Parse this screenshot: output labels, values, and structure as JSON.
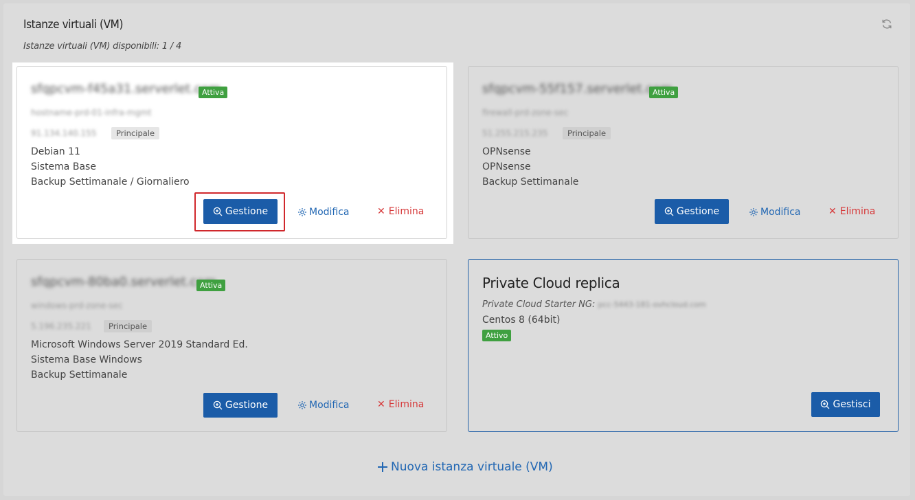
{
  "panel": {
    "title": "Istanze virtuali (VM)",
    "subtitle": "Istanze virtuali (VM) disponibili: 1 / 4"
  },
  "cards": [
    {
      "hostname": "sfqpcvm-f45a31.serverlet.com",
      "status": "Attiva",
      "line1": "hostname-prd-01-infra-mgmt",
      "ip": "91.134.140.155",
      "ip_tag": "Principale",
      "specs": [
        "Debian 11",
        "Sistema Base",
        "Backup Settimanale / Giornaliero"
      ],
      "actions": {
        "manage": "Gestione",
        "edit": "Modifica",
        "delete": "Elimina"
      }
    },
    {
      "hostname": "sfqpcvm-55f157.serverlet.com",
      "status": "Attiva",
      "line1": "firewall-prd-zone-sec",
      "ip": "51.255.215.235",
      "ip_tag": "Principale",
      "specs": [
        "OPNsense",
        "OPNsense",
        "Backup Settimanale"
      ],
      "actions": {
        "manage": "Gestione",
        "edit": "Modifica",
        "delete": "Elimina"
      }
    },
    {
      "hostname": "sfqpcvm-80ba0.serverlet.com",
      "status": "Attiva",
      "line1": "windows-prd-zone-sec",
      "ip": "5.196.235.221",
      "ip_tag": "Principale",
      "specs": [
        "Microsoft Windows Server 2019 Standard Ed.",
        "Sistema Base Windows",
        "Backup Settimanale"
      ],
      "actions": {
        "manage": "Gestione",
        "edit": "Modifica",
        "delete": "Elimina"
      }
    }
  ],
  "private_cloud": {
    "title": "Private Cloud replica",
    "sub_label": "Private Cloud Starter NG:",
    "sub_value": "pcc-5443-181-ovhcloud.com",
    "os": "Centos 8 (64bit)",
    "status": "Attivo",
    "action": "Gestisci"
  },
  "new_vm": "Nuova istanza virtuale (VM)",
  "colors": {
    "primary": "#1b5ca8",
    "link": "#2267b3",
    "danger": "#d6393a",
    "success": "#3fa040",
    "highlight_border": "#d0282c"
  },
  "icons": {
    "refresh": "refresh-icon",
    "zoom": "zoom-in-icon",
    "gear": "gear-icon",
    "close": "close-icon",
    "plus": "plus-icon"
  }
}
